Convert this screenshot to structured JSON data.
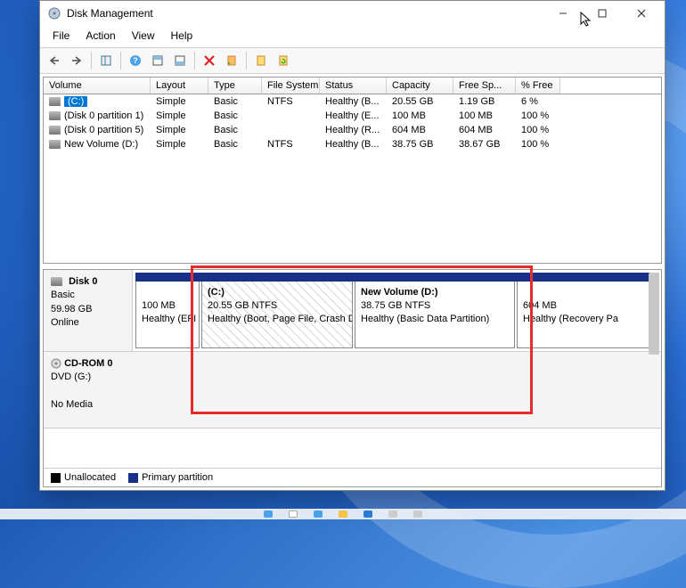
{
  "window": {
    "title": "Disk Management"
  },
  "menu": {
    "items": [
      "File",
      "Action",
      "View",
      "Help"
    ]
  },
  "volume_table": {
    "headers": {
      "volume": "Volume",
      "layout": "Layout",
      "type": "Type",
      "fs": "File System",
      "status": "Status",
      "capacity": "Capacity",
      "free": "Free Sp...",
      "pct": "% Free"
    },
    "rows": [
      {
        "volume": "(C:)",
        "selected": true,
        "layout": "Simple",
        "type": "Basic",
        "fs": "NTFS",
        "status": "Healthy (B...",
        "capacity": "20.55 GB",
        "free": "1.19 GB",
        "pct": "6 %"
      },
      {
        "volume": "(Disk 0 partition 1)",
        "layout": "Simple",
        "type": "Basic",
        "fs": "",
        "status": "Healthy (E...",
        "capacity": "100 MB",
        "free": "100 MB",
        "pct": "100 %"
      },
      {
        "volume": "(Disk 0 partition 5)",
        "layout": "Simple",
        "type": "Basic",
        "fs": "",
        "status": "Healthy (R...",
        "capacity": "604 MB",
        "free": "604 MB",
        "pct": "100 %"
      },
      {
        "volume": "New Volume (D:)",
        "layout": "Simple",
        "type": "Basic",
        "fs": "NTFS",
        "status": "Healthy (B...",
        "capacity": "38.75 GB",
        "free": "38.67 GB",
        "pct": "100 %"
      }
    ]
  },
  "disks": {
    "disk0": {
      "label": "Disk 0",
      "type": "Basic",
      "size": "59.98 GB",
      "state": "Online",
      "partitions": [
        {
          "name": "",
          "line2": "100 MB",
          "line3": "Healthy (EFI S"
        },
        {
          "name": "(C:)",
          "line2": "20.55 GB NTFS",
          "line3": "Healthy (Boot, Page File, Crash Du"
        },
        {
          "name": "New Volume  (D:)",
          "line2": "38.75 GB NTFS",
          "line3": "Healthy (Basic Data Partition)"
        },
        {
          "name": "",
          "line2": "604 MB",
          "line3": "Healthy (Recovery Pa"
        }
      ]
    },
    "cdrom": {
      "label": "CD-ROM 0",
      "type": "DVD (G:)",
      "state": "No Media"
    }
  },
  "legend": {
    "unallocated": "Unallocated",
    "primary": "Primary partition"
  },
  "icons": {
    "disk": "disk-icon"
  }
}
